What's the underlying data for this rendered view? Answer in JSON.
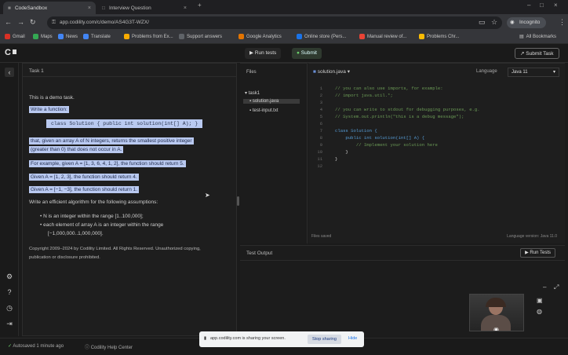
{
  "browser": {
    "tabs": [
      {
        "label": "CodeSandbox",
        "active": true
      },
      {
        "label": "Interview Question",
        "active": false
      }
    ],
    "new_tab": "+",
    "url": "app.codility.com/c/demo/AS4G3T-WZX/",
    "profile_label": "Incognito",
    "bookmarks": [
      {
        "label": "Gmail",
        "color": "#d93025"
      },
      {
        "label": "Maps",
        "color": "#34a853"
      },
      {
        "label": "News",
        "color": "#4285f4"
      },
      {
        "label": "Translate",
        "color": "#4285f4"
      },
      {
        "label": "Problems from Ex...",
        "color": "#f9ab00"
      },
      {
        "label": "Support answers",
        "color": "#5f6368"
      },
      {
        "label": "Google Analytics",
        "color": "#e37400"
      },
      {
        "label": "Online store (Pers...",
        "color": "#1a73e8"
      },
      {
        "label": "Manual review of...",
        "color": "#ea4335"
      },
      {
        "label": "Problems Chr...",
        "color": "#fbbc04"
      }
    ],
    "all_bookmarks": "All Bookmarks"
  },
  "app": {
    "logo": "C",
    "header": {
      "task_label": "Task 1",
      "tab_run": "Run tests",
      "tab_submit": "Submit",
      "submit_task": "Submit Task"
    },
    "problem": {
      "title": "Task 1",
      "lines": [
        "This is a demo task.",
        "Write a function:",
        "class Solution { public int solution(int[] A); }",
        "that, given an array A of N integers, returns the smallest positive integer",
        "(greater than 0) that does not occur in A.",
        "For example, given A = [1, 3, 6, 4, 1, 2], the function should return 5.",
        "Given A = [1, 2, 3], the function should return 4.",
        "Given A = [−1, −3], the function should return 1.",
        "Write an efficient algorithm for the following assumptions:",
        "N is an integer within the range [1..100,000];",
        "each element of array A is an integer within the range",
        "[−1,000,000..1,000,000].",
        "Copyright 2009–2024 by Codility Limited. All Rights Reserved. Unauthorized copying,",
        "publication or disclosure prohibited."
      ]
    },
    "files": {
      "header": "Files",
      "folder": "task1",
      "items": [
        "solution.java",
        "test-input.txt"
      ]
    },
    "editor": {
      "file_tab": "solution.java",
      "language_label": "Language",
      "language_value": "Java 11",
      "lines": [
        "// you can also use imports, for example:",
        "// import java.util.*;",
        "",
        "// you can write to stdout for debugging purposes, e.g.",
        "// System.out.println(\"this is a debug message\");",
        "",
        "class Solution {",
        "    public int solution(int[] A) {",
        "        // Implement your solution here",
        "    }",
        "}",
        ""
      ],
      "status_left": "Files saved",
      "status_right": "Language version: Java 11.0"
    },
    "test_output": {
      "title": "Test Output",
      "run_label": "Run Tests"
    },
    "bottom": {
      "left_note": "Autosaved 1 minute ago",
      "right_note": "Codility Help Center"
    },
    "toast": {
      "message": "app.codility.com is sharing your screen.",
      "stop": "Stop sharing",
      "hide": "Hide"
    }
  }
}
